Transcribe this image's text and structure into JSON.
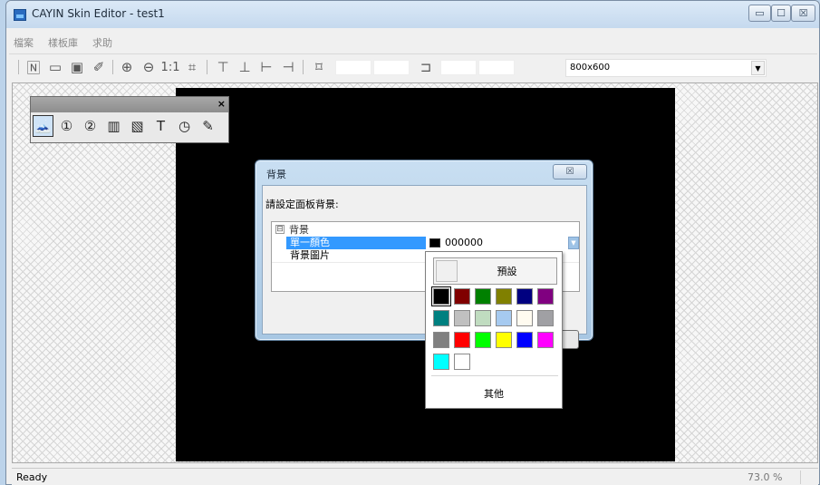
{
  "window": {
    "title": "CAYIN Skin Editor - test1",
    "controls": {
      "minimize": "▭",
      "maximize": "☐",
      "close": "☒"
    }
  },
  "menu": [
    "檔案",
    "樣板庫",
    "求助"
  ],
  "toolbar": {
    "icons": [
      "new-icon",
      "open-icon",
      "import-icon",
      "edit-icon",
      "zoom-in-icon",
      "zoom-out-icon",
      "actual-size-icon",
      "fit-icon",
      "align-top-icon",
      "align-bottom-icon",
      "align-left-icon",
      "align-right-icon",
      "size-icon",
      "rotate-icon"
    ],
    "resolution": "800x600"
  },
  "palette": {
    "close": "×",
    "tools": [
      {
        "name": "background-tool-icon",
        "glyph": "🗻"
      },
      {
        "name": "zone1-tool-icon",
        "glyph": "①"
      },
      {
        "name": "zone2-tool-icon",
        "glyph": "②"
      },
      {
        "name": "zone3-tool-icon",
        "glyph": "▥"
      },
      {
        "name": "zone4-tool-icon",
        "glyph": "▧"
      },
      {
        "name": "text-tool-icon",
        "glyph": "T"
      },
      {
        "name": "clock-tool-icon",
        "glyph": "◷"
      },
      {
        "name": "tool-icon",
        "glyph": "✎"
      }
    ]
  },
  "dialog": {
    "title": "背景",
    "close": "☒",
    "prompt": "請設定面板背景:",
    "category": "背景",
    "category_toggle": "⊟",
    "row1_name": "單一顏色",
    "row1_value": "000000",
    "row2_name": "背景圖片"
  },
  "color_popup": {
    "default_label": "預設",
    "other_label": "其他",
    "swatches": [
      [
        "#000000",
        "#800000",
        "#008000",
        "#808000",
        "#000080",
        "#800080"
      ],
      [
        "#008080",
        "#c0c0c0",
        "#c0dcc0",
        "#a6caf0",
        "#fffbf0",
        "#a0a0a4"
      ],
      [
        "#808080",
        "#ff0000",
        "#00ff00",
        "#ffff00",
        "#0000ff",
        "#ff00ff"
      ],
      [
        "#00ffff",
        "#ffffff"
      ]
    ],
    "selected": "#000000"
  },
  "status": {
    "ready": "Ready",
    "zoom": "73.0 %"
  }
}
